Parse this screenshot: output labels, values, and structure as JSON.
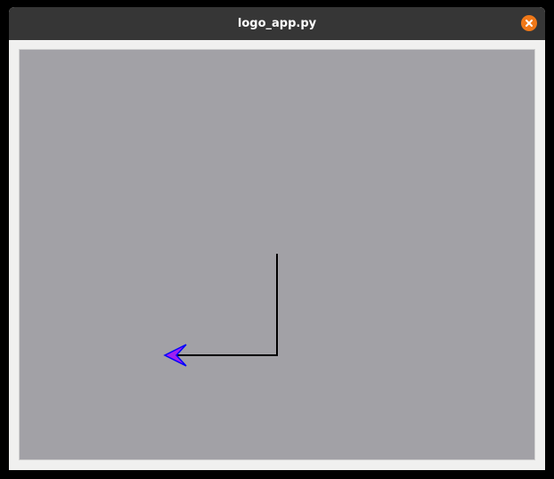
{
  "window": {
    "title": "logo_app.py"
  },
  "titlebar_buttons": {
    "close_icon": "close-icon",
    "close_color": "#f07818"
  },
  "canvas": {
    "background": "#a2a1a6",
    "pen_color": "#000000",
    "turtle_fill": "#a020f0",
    "turtle_outline": "#0000ff",
    "turtle_heading": "left"
  }
}
